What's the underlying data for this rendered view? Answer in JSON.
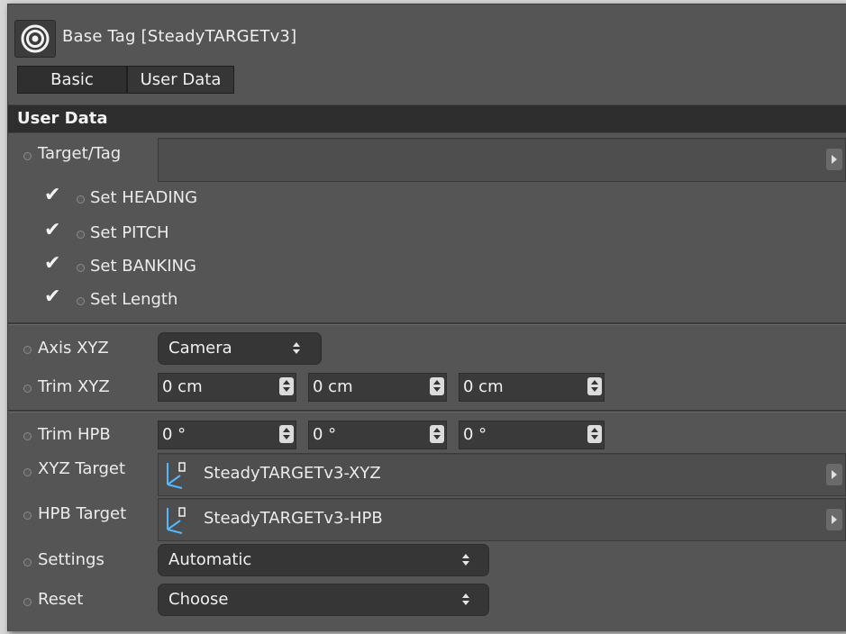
{
  "window": {
    "title": "Base Tag [SteadyTARGETv3]"
  },
  "tabs": [
    {
      "label": "Basic"
    },
    {
      "label": "User Data"
    }
  ],
  "section": {
    "title": "User Data"
  },
  "target_tag": {
    "label": "Target/Tag",
    "value": ""
  },
  "checks": [
    {
      "label": "Set HEADING",
      "checked": true
    },
    {
      "label": "Set PITCH",
      "checked": true
    },
    {
      "label": "Set BANKING",
      "checked": true
    },
    {
      "label": "Set Length",
      "checked": true
    }
  ],
  "axis_xyz": {
    "label": "Axis XYZ",
    "value": "Camera"
  },
  "trim_xyz": {
    "label": "Trim XYZ",
    "values": [
      "0 cm",
      "0 cm",
      "0 cm"
    ]
  },
  "trim_hpb": {
    "label": "Trim HPB",
    "values": [
      "0 °",
      "0 °",
      "0 °"
    ]
  },
  "xyz_target": {
    "label": "XYZ Target",
    "value": "SteadyTARGETv3-XYZ"
  },
  "hpb_target": {
    "label": "HPB Target",
    "value": "SteadyTARGETv3-HPB"
  },
  "settings": {
    "label": "Settings",
    "value": "Automatic"
  },
  "reset": {
    "label": "Reset",
    "value": "Choose"
  },
  "icons": {
    "tag": "target-icon",
    "link": "null-object-icon",
    "check": "checkmark-icon"
  },
  "colors": {
    "panel": "#555555",
    "field": "#3a3a3a",
    "header": "#2e2e2e"
  }
}
